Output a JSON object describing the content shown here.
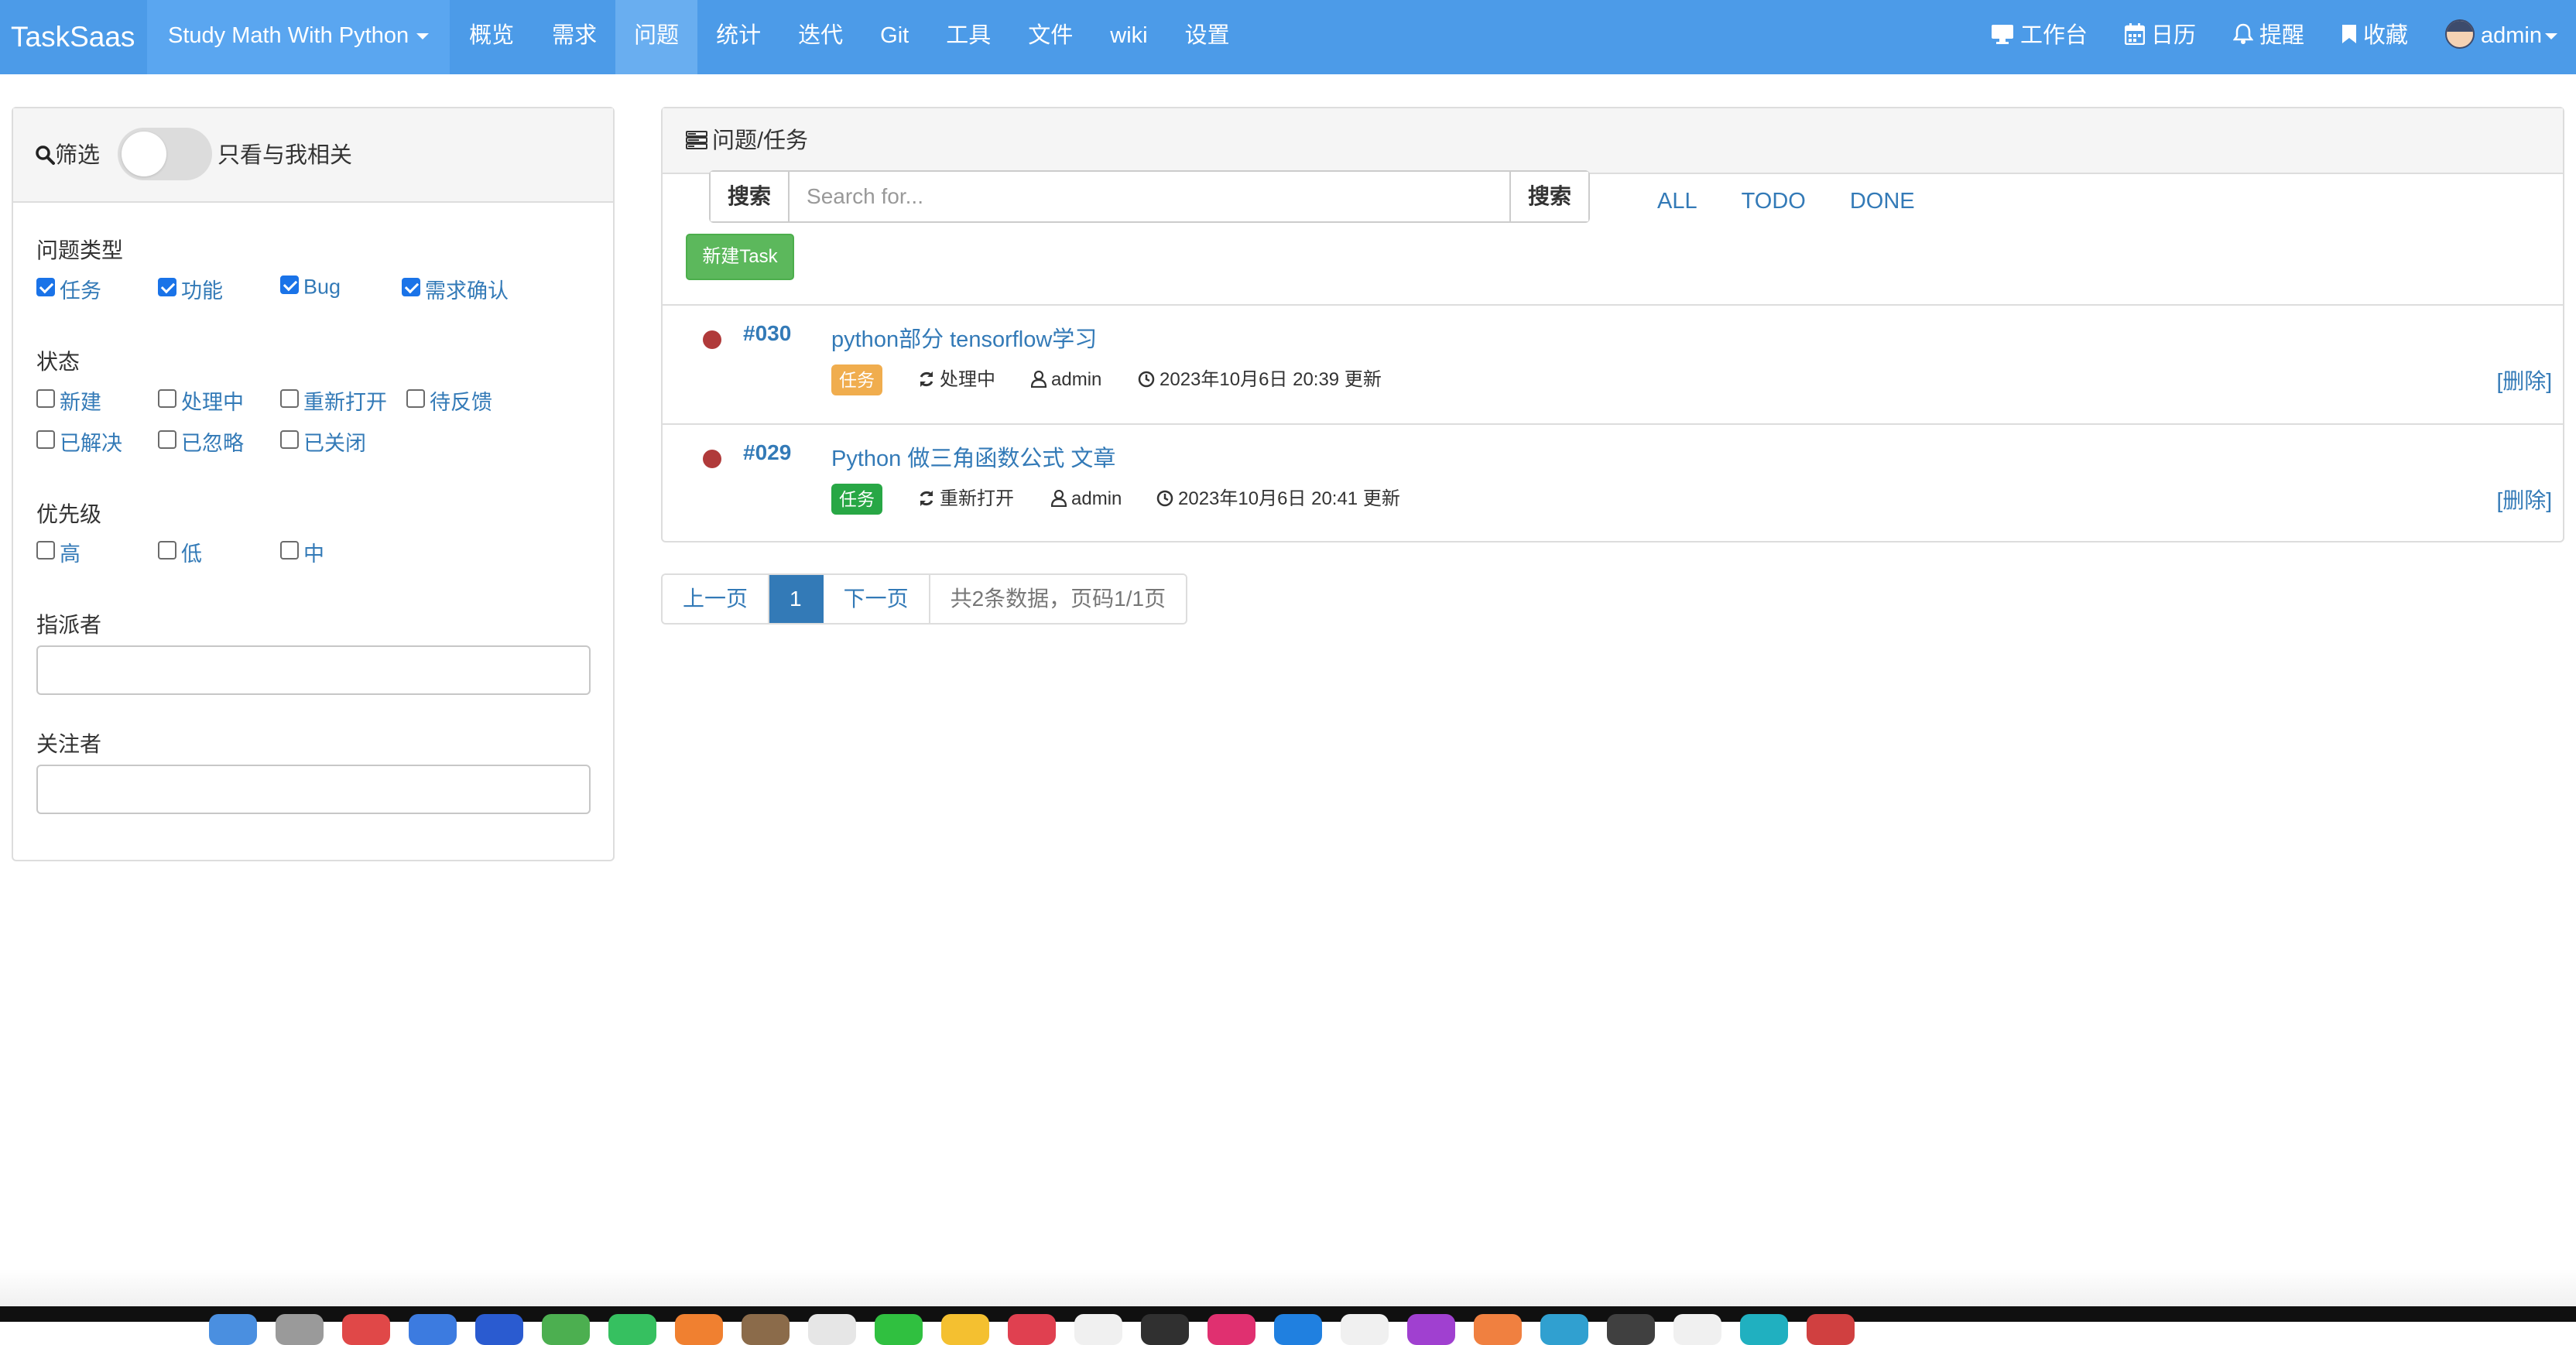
{
  "navbar": {
    "brand": "TaskSaas",
    "project": "Study Math With Python",
    "menu": [
      "概览",
      "需求",
      "问题",
      "统计",
      "迭代",
      "Git",
      "工具",
      "文件",
      "wiki",
      "设置"
    ],
    "active_menu": "问题",
    "right": {
      "workbench": "工作台",
      "calendar": "日历",
      "remind": "提醒",
      "favorites": "收藏",
      "user": "admin"
    }
  },
  "filter": {
    "title": "筛选",
    "toggle_label": "只看与我相关",
    "toggle_on": false,
    "issue_type": {
      "label": "问题类型",
      "options": [
        {
          "label": "任务",
          "checked": true
        },
        {
          "label": "功能",
          "checked": true
        },
        {
          "label": "Bug",
          "checked": true
        },
        {
          "label": "需求确认",
          "checked": true
        }
      ]
    },
    "status": {
      "label": "状态",
      "options": [
        {
          "label": "新建",
          "checked": false
        },
        {
          "label": "处理中",
          "checked": false
        },
        {
          "label": "重新打开",
          "checked": false
        },
        {
          "label": "待反馈",
          "checked": false
        },
        {
          "label": "已解决",
          "checked": false
        },
        {
          "label": "已忽略",
          "checked": false
        },
        {
          "label": "已关闭",
          "checked": false
        }
      ]
    },
    "priority": {
      "label": "优先级",
      "options": [
        {
          "label": "高",
          "checked": false
        },
        {
          "label": "低",
          "checked": false
        },
        {
          "label": "中",
          "checked": false
        }
      ]
    },
    "assignee": {
      "label": "指派者",
      "value": ""
    },
    "watcher": {
      "label": "关注者",
      "value": ""
    }
  },
  "issues_panel": {
    "title": "问题/任务",
    "search": {
      "left_button": "搜索",
      "placeholder": "Search for...",
      "right_button": "搜索"
    },
    "status_tabs": [
      "ALL",
      "TODO",
      "DONE"
    ],
    "new_button": "新建Task",
    "rows": [
      {
        "id": "#030",
        "title": "python部分 tensorflow学习",
        "type": "任务",
        "type_color": "#f0ad4e",
        "status": "处理中",
        "assignee": "admin",
        "updated": "2023年10月6日 20:39 更新",
        "delete": "[删除]"
      },
      {
        "id": "#029",
        "title": "Python 做三角函数公式 文章",
        "type": "任务",
        "type_color": "#28a745",
        "status": "重新打开",
        "assignee": "admin",
        "updated": "2023年10月6日 20:41 更新",
        "delete": "[删除]"
      }
    ]
  },
  "pagination": {
    "prev": "上一页",
    "current": "1",
    "next": "下一页",
    "info": "共2条数据，页码1/1页"
  }
}
